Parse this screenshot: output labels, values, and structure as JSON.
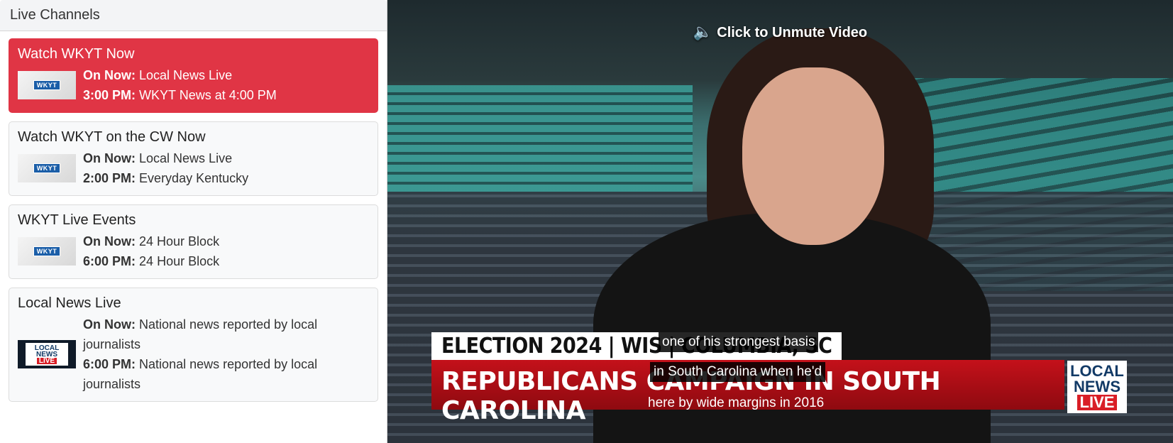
{
  "sidebar": {
    "title": "Live Channels",
    "channels": [
      {
        "title": "Watch WKYT Now",
        "thumb": "WKYT",
        "now_label": "On Now:",
        "now_value": "Local News Live",
        "next_label": "3:00 PM:",
        "next_value": "WKYT News at 4:00 PM",
        "active": true
      },
      {
        "title": "Watch WKYT on the CW Now",
        "thumb": "WKYT",
        "now_label": "On Now:",
        "now_value": "Local News Live",
        "next_label": "2:00 PM:",
        "next_value": "Everyday Kentucky",
        "active": false
      },
      {
        "title": "WKYT Live Events",
        "thumb": "WKYT",
        "now_label": "On Now:",
        "now_value": "24 Hour Block",
        "next_label": "6:00 PM:",
        "next_value": "24 Hour Block",
        "active": false
      },
      {
        "title": "Local News Live",
        "thumb_lines": [
          "LOCAL",
          "NEWS",
          "LIVE"
        ],
        "now_label": "On Now:",
        "now_value": "National news reported by local journalists",
        "next_label": "6:00 PM:",
        "next_value": "National news reported by local journalists",
        "active": false
      }
    ]
  },
  "video": {
    "unmute_label": "Click to Unmute Video",
    "unmute_icon": "speaker-icon",
    "lower_third_top": "ELECTION 2024 | WIS | COLUMBIA, SC",
    "lower_third_main": "REPUBLICANS CAMPAIGN IN SOUTH CAROLINA",
    "logo_lines": [
      "LOCAL",
      "NEWS",
      "LIVE"
    ],
    "captions": [
      "one of his strongest basis",
      "in South Carolina when he'd",
      "here by wide margins in 2016"
    ]
  },
  "colors": {
    "active_channel": "#e03545",
    "lower_third_red": "#c4111a"
  }
}
